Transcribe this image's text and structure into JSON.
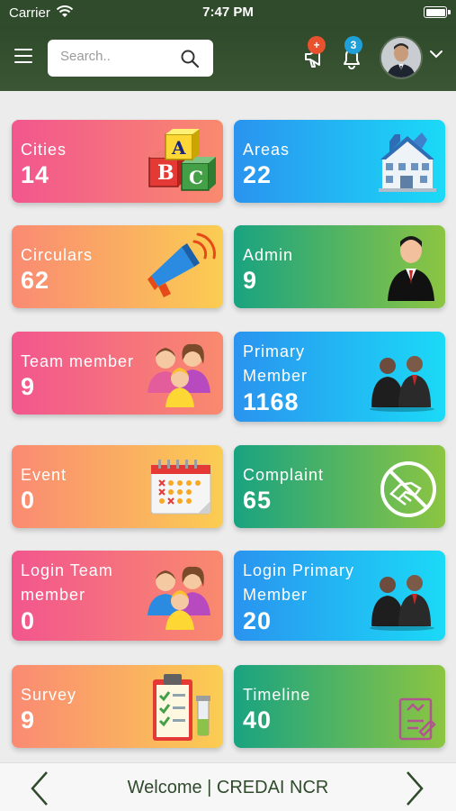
{
  "status_bar": {
    "carrier": "Carrier",
    "time": "7:47 PM",
    "icons": [
      "wifi-icon",
      "battery-icon"
    ]
  },
  "header": {
    "menu_icon": "hamburger-menu-icon",
    "search": {
      "placeholder": "Search..",
      "value": "",
      "icon": "search-icon"
    },
    "announcements": {
      "icon": "megaphone-icon",
      "badge": "+",
      "badge_color": "#e8522f"
    },
    "notifications": {
      "icon": "bell-icon",
      "badge": "3",
      "badge_color": "#20a0d8"
    },
    "profile": {
      "icon": "avatar",
      "dropdown_icon": "chevron-down-icon"
    }
  },
  "cards": [
    {
      "label": "Cities",
      "count": "14",
      "icon": "abc-blocks-icon",
      "gradient": "pink"
    },
    {
      "label": "Areas",
      "count": "22",
      "icon": "building-icon",
      "gradient": "blue"
    },
    {
      "label": "Circulars",
      "count": "62",
      "icon": "megaphone-icon",
      "gradient": "orange"
    },
    {
      "label": "Admin",
      "count": "9",
      "icon": "businessman-icon",
      "gradient": "green"
    },
    {
      "label": "Team member",
      "count": "9",
      "icon": "family-group-icon",
      "gradient": "pink"
    },
    {
      "label": "Primary Member",
      "count": "1168",
      "icon": "business-meeting-icon",
      "gradient": "blue"
    },
    {
      "label": "Event",
      "count": "0",
      "icon": "calendar-icon",
      "gradient": "orange"
    },
    {
      "label": "Complaint",
      "count": "65",
      "icon": "no-handshake-icon",
      "gradient": "green"
    },
    {
      "label": "Login Team member",
      "count": "0",
      "icon": "family-group-icon",
      "gradient": "pink"
    },
    {
      "label": "Login Primary Member",
      "count": "20",
      "icon": "business-meeting-icon",
      "gradient": "blue"
    },
    {
      "label": "Survey",
      "count": "9",
      "icon": "clipboard-checklist-icon",
      "gradient": "orange"
    },
    {
      "label": "Timeline",
      "count": "40",
      "icon": "timeline-document-icon",
      "gradient": "green"
    }
  ],
  "footer": {
    "welcome_text": "Welcome | CREDAI NCR",
    "prev_icon": "chevron-left-icon",
    "next_icon": "chevron-right-icon"
  },
  "colors": {
    "header_bg": "#2f4b2b",
    "pink_gradient": [
      "#f2568e",
      "#f98a6e"
    ],
    "blue_gradient": [
      "#2a93ef",
      "#1bdaf7"
    ],
    "orange_gradient": [
      "#fa8a73",
      "#fbcd52"
    ],
    "green_gradient": [
      "#19a381",
      "#8cc542"
    ]
  }
}
